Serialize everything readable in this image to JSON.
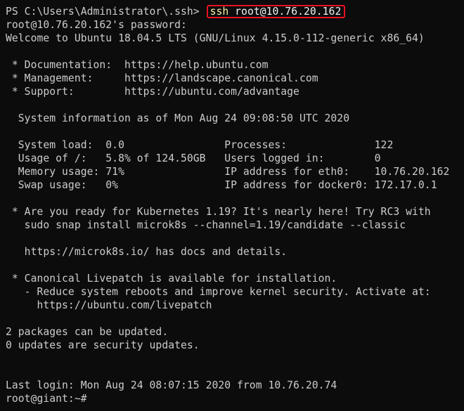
{
  "window": {
    "background": "#0c0c0c",
    "foreground": "#cccccc",
    "highlight_border": "#e81123",
    "keyword_color": "#f9f1a5"
  },
  "prompt": {
    "ps_prefix": "PS C:\\Users\\Administrator\\.ssh> ",
    "command_keyword": "ssh",
    "command_args": " root@10.76.20.162"
  },
  "lines": [
    "root@10.76.20.162's password:",
    "Welcome to Ubuntu 18.04.5 LTS (GNU/Linux 4.15.0-112-generic x86_64)",
    "",
    " * Documentation:  https://help.ubuntu.com",
    " * Management:     https://landscape.canonical.com",
    " * Support:        https://ubuntu.com/advantage",
    "",
    "  System information as of Mon Aug 24 09:08:50 UTC 2020",
    "",
    "  System load:  0.0                Processes:              122",
    "  Usage of /:   5.8% of 124.50GB   Users logged in:        0",
    "  Memory usage: 71%                IP address for eth0:    10.76.20.162",
    "  Swap usage:   0%                 IP address for docker0: 172.17.0.1",
    "",
    " * Are you ready for Kubernetes 1.19? It's nearly here! Try RC3 with",
    "   sudo snap install microk8s --channel=1.19/candidate --classic",
    "",
    "   https://microk8s.io/ has docs and details.",
    "",
    " * Canonical Livepatch is available for installation.",
    "   - Reduce system reboots and improve kernel security. Activate at:",
    "     https://ubuntu.com/livepatch",
    "",
    "2 packages can be updated.",
    "0 updates are security updates.",
    "",
    "",
    "Last login: Mon Aug 24 08:07:15 2020 from 10.76.20.74",
    "root@giant:~#"
  ]
}
